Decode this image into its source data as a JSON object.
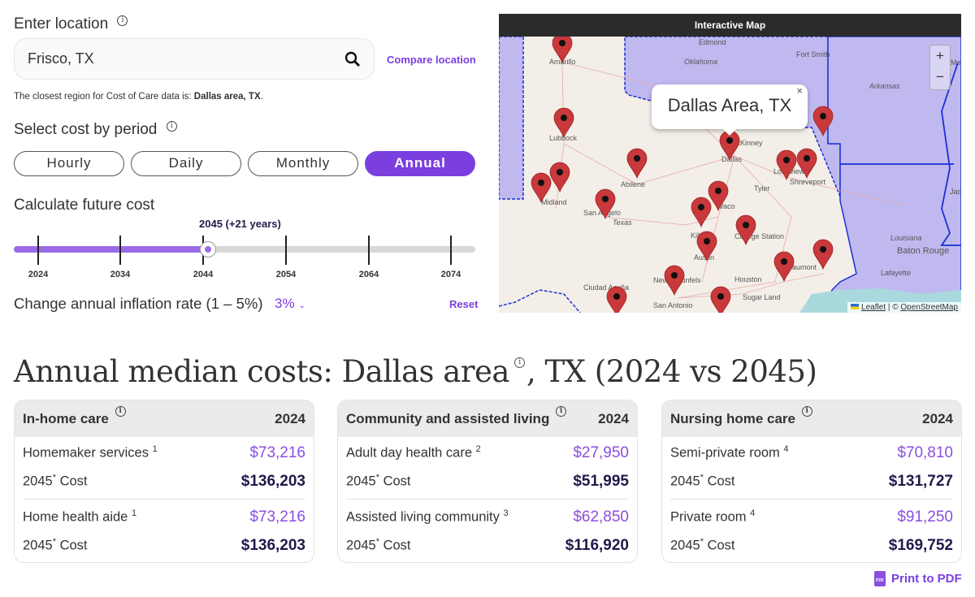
{
  "location": {
    "label": "Enter location",
    "value": "Frisco, TX",
    "compare": "Compare location",
    "note_prefix": "The closest region for Cost of Care data is: ",
    "note_region": "Dallas area, TX",
    "note_suffix": "."
  },
  "period": {
    "label": "Select cost by period",
    "options": [
      "Hourly",
      "Daily",
      "Monthly",
      "Annual"
    ],
    "selected": "Annual"
  },
  "future": {
    "label": "Calculate future cost",
    "selected_label": "2045 (+21 years)",
    "selected_year": 2045,
    "ticks": [
      "2024",
      "2034",
      "2044",
      "2054",
      "2064",
      "2074"
    ],
    "progress_fraction": 0.42
  },
  "inflation": {
    "label": "Change annual inflation rate (1 – 5%)",
    "value": "3%",
    "reset": "Reset"
  },
  "map": {
    "title": "Interactive Map",
    "popup": "Dallas Area, TX",
    "popup_close": "×",
    "zoom_in": "+",
    "zoom_out": "−",
    "attribution_leaflet": "Leaflet",
    "attribution_sep": " | © ",
    "attribution_osm": "OpenStreetMap",
    "cities": [
      "Amarillo",
      "Edmond",
      "Oklahoma",
      "Fort Smith",
      "Arkansas",
      "Lubbock",
      "McKinney",
      "Dallas",
      "Abilene",
      "Midland",
      "Tyler",
      "Longview",
      "Shreveport",
      "San Angelo",
      "Texas",
      "Waco",
      "Killeen",
      "College Station",
      "Austin",
      "Houston",
      "Beaumont",
      "Baton Rouge",
      "Lafayette",
      "Louisiana",
      "New Braunfels",
      "San Antonio",
      "Ciudad Acuña",
      "Sugar Land",
      "Jackson",
      "Memphis"
    ]
  },
  "heading": {
    "prefix": "Annual median costs: Dallas area",
    "suffix": ", TX (2024 vs 2045)"
  },
  "cards": [
    {
      "title": "In-home care",
      "year": "2024",
      "items": [
        {
          "name": "Homemaker services",
          "note": "1",
          "cost_2024": "$73,216",
          "future_label": "2045",
          "future_suffix": "Cost",
          "cost_future": "$136,203"
        },
        {
          "name": "Home health aide",
          "note": "1",
          "cost_2024": "$73,216",
          "future_label": "2045",
          "future_suffix": "Cost",
          "cost_future": "$136,203"
        }
      ]
    },
    {
      "title": "Community and assisted living",
      "year": "2024",
      "items": [
        {
          "name": "Adult day health care",
          "note": "2",
          "cost_2024": "$27,950",
          "future_label": "2045",
          "future_suffix": "Cost",
          "cost_future": "$51,995"
        },
        {
          "name": "Assisted living community",
          "note": "3",
          "cost_2024": "$62,850",
          "future_label": "2045",
          "future_suffix": "Cost",
          "cost_future": "$116,920"
        }
      ]
    },
    {
      "title": "Nursing home care",
      "year": "2024",
      "items": [
        {
          "name": "Semi-private room",
          "note": "4",
          "cost_2024": "$70,810",
          "future_label": "2045",
          "future_suffix": "Cost",
          "cost_future": "$131,727"
        },
        {
          "name": "Private room",
          "note": "4",
          "cost_2024": "$91,250",
          "future_label": "2045",
          "future_suffix": "Cost",
          "cost_future": "$169,752"
        }
      ]
    }
  ],
  "print": "Print to PDF",
  "colors": {
    "accent": "#7b3fe0",
    "navy": "#1f1a4a",
    "pin": "#c9383a"
  }
}
